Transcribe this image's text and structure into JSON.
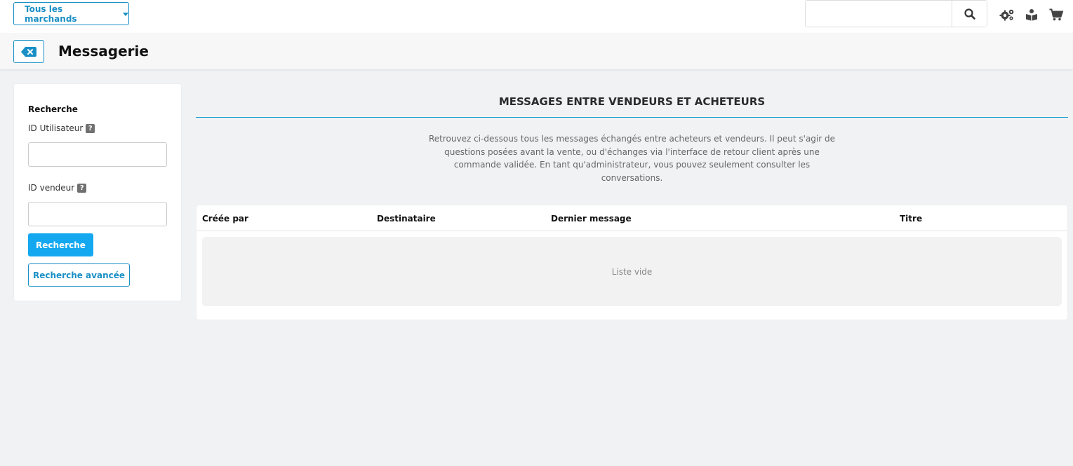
{
  "topbar": {
    "merchant_select_label": "Tous les marchands",
    "search": {
      "value": "",
      "placeholder": ""
    },
    "icons": [
      "search-icon",
      "settings-gears-icon",
      "book-reader-icon",
      "shopping-cart-icon"
    ]
  },
  "titlebar": {
    "back_icon": "backspace-icon",
    "title": "Messagerie"
  },
  "sidebar": {
    "heading": "Recherche",
    "user_id_label": "ID Utilisateur",
    "user_id_value": "",
    "vendor_id_label": "ID vendeur",
    "vendor_id_value": "",
    "help_glyph": "?",
    "search_button": "Recherche",
    "advanced_search_button": "Recherche avancée"
  },
  "main": {
    "section_title": "MESSAGES ENTRE VENDEURS ET ACHETEURS",
    "description": "Retrouvez ci-dessous tous les messages échangés entre acheteurs et vendeurs. Il peut s'agir de questions posées avant la vente, ou d'échanges via l'interface de retour client après une commande validée. En tant qu'administrateur, vous pouvez seulement consulter les conversations.",
    "table": {
      "columns": [
        "Créée par",
        "Destinataire",
        "Dernier message",
        "Titre"
      ],
      "rows": [],
      "empty_text": "Liste vide"
    }
  },
  "colors": {
    "accent": "#1a8fc5",
    "primary_button": "#14a8f0",
    "background": "#f1f2f4"
  }
}
